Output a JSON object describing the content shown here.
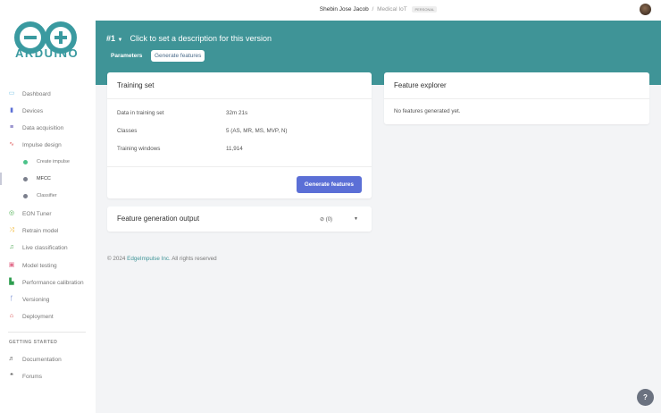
{
  "logo": {
    "text": "ARDUINO"
  },
  "sidebar": {
    "items": [
      {
        "label": "Dashboard",
        "icon": "monitor-icon",
        "color": "#7fc6e6"
      },
      {
        "label": "Devices",
        "icon": "chip-icon",
        "color": "#5b6fd6"
      },
      {
        "label": "Data acquisition",
        "icon": "database-icon",
        "color": "#3b2fa0"
      },
      {
        "label": "Impulse design",
        "icon": "pulse-icon",
        "color": "#e26b6b"
      },
      {
        "label": "EON Tuner",
        "icon": "tuner-icon",
        "color": "#4caf50"
      },
      {
        "label": "Retrain model",
        "icon": "shuffle-icon",
        "color": "#f2b632"
      },
      {
        "label": "Live classification",
        "icon": "live-icon",
        "color": "#43a047"
      },
      {
        "label": "Model testing",
        "icon": "clipboard-icon",
        "color": "#e26b8a"
      },
      {
        "label": "Performance calibration",
        "icon": "chart-icon",
        "color": "#2e9e4f"
      },
      {
        "label": "Versioning",
        "icon": "branch-icon",
        "color": "#3b5bbf"
      },
      {
        "label": "Deployment",
        "icon": "package-icon",
        "color": "#d32f2f"
      }
    ],
    "subitems": [
      {
        "label": "Create impulse",
        "color": "#4cc38a"
      },
      {
        "label": "MFCC",
        "color": "#7b7f8c"
      },
      {
        "label": "Classifier",
        "color": "#7b7f8c"
      }
    ],
    "section": "GETTING STARTED",
    "getting_started": [
      {
        "label": "Documentation",
        "icon": "docs-icon"
      },
      {
        "label": "Forums",
        "icon": "forum-icon"
      }
    ]
  },
  "topbar": {
    "user": "Shebin Jose Jacob",
    "separator": "/",
    "project": "Medical IoT",
    "badge": "PERSONAL"
  },
  "hero": {
    "version": "#1",
    "description": "Click to set a description for this version",
    "tabs": [
      "Parameters",
      "Generate features"
    ]
  },
  "training": {
    "title": "Training set",
    "rows": [
      {
        "label": "Data in training set",
        "value": "32m 21s"
      },
      {
        "label": "Classes",
        "value": "5 (AS, MR, MS, MVP, N)"
      },
      {
        "label": "Training windows",
        "value": "11,914"
      }
    ],
    "button": "Generate features"
  },
  "output": {
    "title": "Feature generation output",
    "count": "(0)"
  },
  "explorer": {
    "title": "Feature explorer",
    "empty": "No features generated yet."
  },
  "footer": {
    "prefix": "© 2024",
    "link": "EdgeImpulse Inc.",
    "suffix": "All rights reserved"
  }
}
